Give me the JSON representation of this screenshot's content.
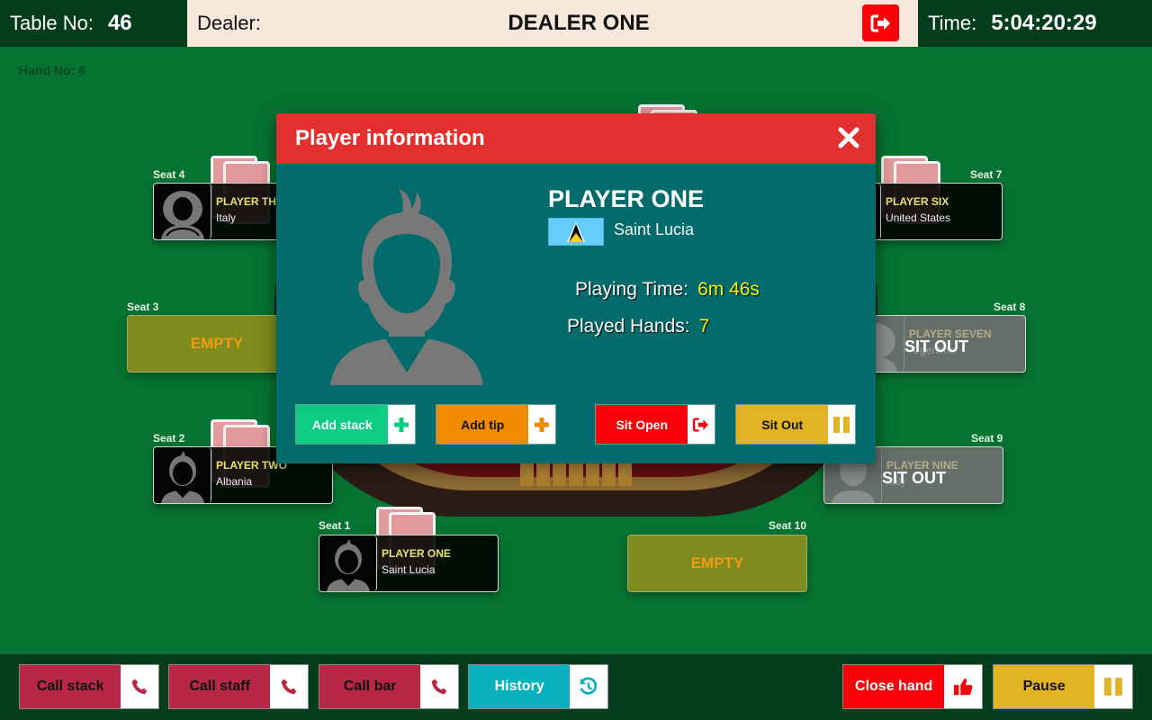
{
  "topbar": {
    "table_label": "Table No:",
    "table_number": "46",
    "dealer_label": "Dealer:",
    "dealer_name": "DEALER ONE",
    "time_label": "Time:",
    "time_value": "5:04:20:29"
  },
  "hand": {
    "label": "Hand No: 8"
  },
  "seats": {
    "s1": {
      "label": "Seat 1",
      "name": "PLAYER ONE",
      "country": "Saint Lucia",
      "status": "active"
    },
    "s2": {
      "label": "Seat 2",
      "name": "PLAYER TWO",
      "country": "Albania",
      "status": "active"
    },
    "s3": {
      "label": "Seat 3",
      "status_text": "EMPTY"
    },
    "s4": {
      "label": "Seat 4",
      "name": "PLAYER THREE",
      "country": "Italy",
      "status": "active"
    },
    "s7": {
      "label": "Seat 7",
      "name": "PLAYER SIX",
      "country": "United States",
      "status": "active"
    },
    "s8": {
      "label": "Seat 8",
      "name": "PLAYER SEVEN",
      "country": "Argentina",
      "status_text": "SIT OUT"
    },
    "s9": {
      "label": "Seat 9",
      "name": "PLAYER NINE",
      "country": "Italy",
      "status_text": "SIT OUT"
    },
    "s10": {
      "label": "Seat 10",
      "status_text": "EMPTY"
    }
  },
  "modal": {
    "title": "Player information",
    "player_name": "PLAYER ONE",
    "country": "Saint Lucia",
    "flag": "saint-lucia-flag",
    "playing_time_label": "Playing Time:",
    "playing_time_value": "6m 46s",
    "played_hands_label": "Played Hands:",
    "played_hands_value": "7",
    "buttons": {
      "add_stack": "Add stack",
      "add_tip": "Add tip",
      "sit_open": "Sit Open",
      "sit_out": "Sit Out"
    }
  },
  "bottombar": {
    "call_stack": "Call stack",
    "call_staff": "Call staff",
    "call_bar": "Call bar",
    "history": "History",
    "close_hand": "Close hand",
    "pause": "Pause"
  },
  "colors": {
    "felt": "#077332",
    "bar": "#033d1c",
    "modal_header": "#e3302f",
    "modal_body": "#036b6b",
    "crimson": "#b82745",
    "teal": "#08b1bf",
    "red": "#fb0008",
    "gold": "#e2b324",
    "green": "#0ccd83",
    "orange": "#f08b00"
  }
}
